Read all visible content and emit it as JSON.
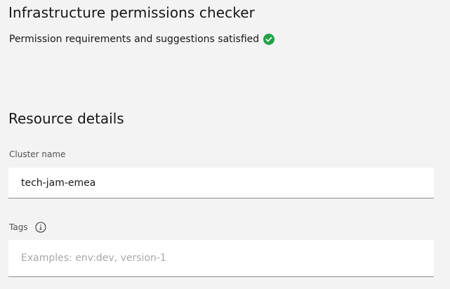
{
  "page": {
    "title": "Infrastructure permissions checker",
    "status_text": "Permission requirements and suggestions satisfied",
    "status_icon": "checkmark-filled-icon",
    "status_color": "#24a148"
  },
  "resource_details": {
    "heading": "Resource details",
    "cluster_name": {
      "label": "Cluster name",
      "value": "tech-jam-emea"
    },
    "tags": {
      "label": "Tags",
      "info_icon": "information-icon",
      "value": "",
      "placeholder": "Examples: env:dev, version-1"
    }
  }
}
